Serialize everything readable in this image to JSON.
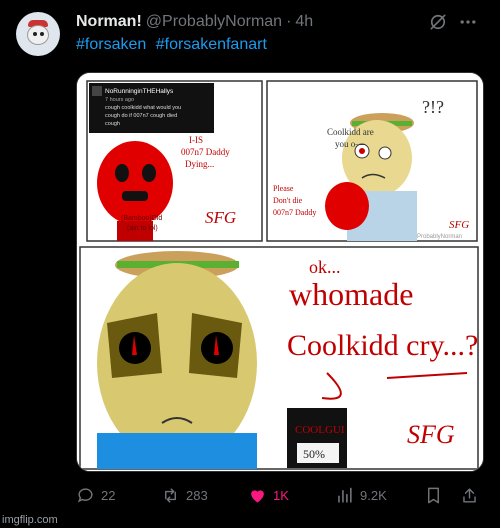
{
  "post": {
    "display_name": "Norman!",
    "handle": "@ProbablyNorman",
    "separator": "·",
    "time": "4h",
    "hashtags": [
      "#forsaken",
      "#forsakenfanart"
    ]
  },
  "media": {
    "comment": {
      "user": "NoRunninginTHEHallys",
      "time": "7 hours ago",
      "line1": "cough coolkidd what would you",
      "line2": "cough do if 007n7 cough died",
      "line3": "cough"
    },
    "panel1_speech": [
      "I-IS",
      "007n7 Daddy",
      "Dying..."
    ],
    "panel1_caption": [
      "(Bamboo)Did",
      "(ain to lol)"
    ],
    "panel2_speech": [
      "Coolkidd are",
      "you o—"
    ],
    "panel2_marks": "?!?",
    "panel2_caption": [
      "Please",
      "Don't die",
      "007n7 Daddy"
    ],
    "panel3_ok": "ok...",
    "panel3_line1": "whomade",
    "panel3_line2": "Coolkidd cry...?",
    "card_name": "COOLGUI",
    "card_value": "50%",
    "signature": "SFG",
    "credit": "ProbablyNorman"
  },
  "actions": {
    "replies": "22",
    "reposts": "283",
    "likes": "1K",
    "views": "9.2K"
  },
  "colors": {
    "link": "#1d9bf0",
    "like": "#f91880",
    "muted": "#71767b",
    "text": "#e7e9ea"
  },
  "watermark": "imgflip.com"
}
